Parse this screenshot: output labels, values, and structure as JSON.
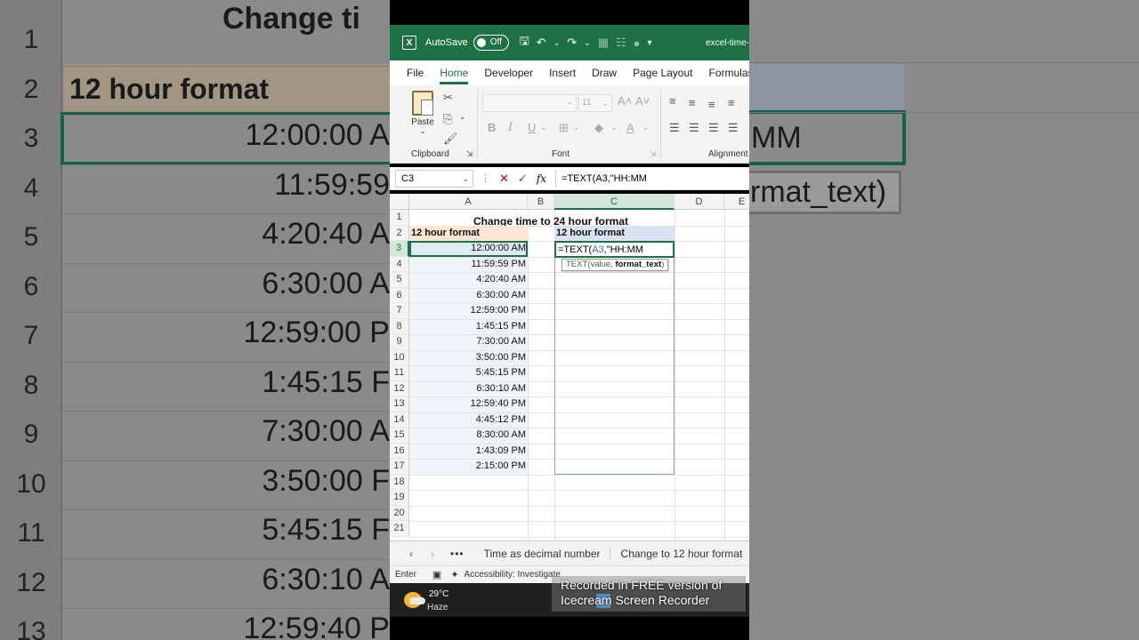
{
  "titlebar": {
    "autosave_label": "AutoSave",
    "toggle_state": "Off",
    "filename": "excel-time-"
  },
  "menu": [
    "File",
    "Home",
    "Developer",
    "Insert",
    "Draw",
    "Page Layout",
    "Formulas"
  ],
  "menu_active": "Home",
  "ribbon": {
    "paste_label": "Paste",
    "font_size": "11",
    "groups": {
      "clipboard": "Clipboard",
      "font": "Font",
      "alignment": "Alignment"
    }
  },
  "formula_bar": {
    "name_box": "C3",
    "formula": "=TEXT(A3,\"HH:MM"
  },
  "columns": [
    "A",
    "B",
    "C",
    "D",
    "E"
  ],
  "rows": [
    "1",
    "2",
    "3",
    "4",
    "5",
    "6",
    "7",
    "8",
    "9",
    "10",
    "11",
    "12",
    "13",
    "14",
    "15",
    "16",
    "17",
    "18",
    "19",
    "20",
    "21"
  ],
  "sheet": {
    "title": "Change time to 24 hour format",
    "header_a": "12 hour format",
    "header_c": "12 hour format",
    "times": [
      "12:00:00 AM",
      "11:59:59 PM",
      "4:20:40 AM",
      "6:30:00 AM",
      "12:59:00 PM",
      "1:45:15 PM",
      "7:30:00 AM",
      "3:50:00 PM",
      "5:45:15 PM",
      "6:30:10 AM",
      "12:59:40 PM",
      "4:45:12 PM",
      "8:30:00 AM",
      "1:43:09 PM",
      "2:15:00 PM"
    ],
    "edit_prefix": "=TEXT(",
    "edit_ref": "A3",
    "edit_suffix": ",\"HH:MM",
    "tooltip_fn": "TEXT(value, ",
    "tooltip_arg": "format_text",
    "tooltip_close": ")"
  },
  "sheet_tabs": [
    "Time as decimal number",
    "Change to 12 hour format"
  ],
  "status": {
    "mode": "Enter",
    "accessibility": "Accessibility: Investigate"
  },
  "taskbar": {
    "temp": "29°C",
    "condition": "Haze"
  },
  "watermark": {
    "line1": "Recorded in FREE version of",
    "line2": "Icecream Screen Recorder"
  },
  "background": {
    "left_title": "Change ti",
    "left_header": "12 hour format",
    "left_rows": [
      "1",
      "2",
      "3",
      "4",
      "5",
      "6",
      "7",
      "8",
      "9",
      "10",
      "11",
      "12",
      "13"
    ],
    "left_times": [
      "12:00:00 A",
      "11:59:59",
      "4:20:40 A",
      "6:30:00 A",
      "12:59:00 P",
      "1:45:15 F",
      "7:30:00 A",
      "3:50:00 F",
      "5:45:15 F",
      "6:30:10 A",
      "12:59:40 P"
    ],
    "right_formula": "MM",
    "right_tooltip": "rmat_text)"
  },
  "colors": {
    "excel_green": "#1e7145",
    "header_a_fill": "#fde6d4",
    "header_c_fill": "#d9e1f2",
    "ref_blue": "#3a6fb6"
  }
}
